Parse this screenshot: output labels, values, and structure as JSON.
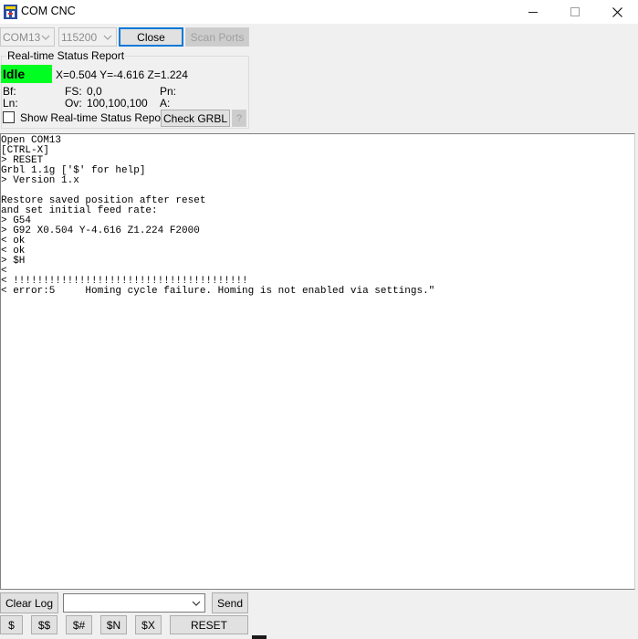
{
  "window": {
    "title": "COM CNC",
    "icons": [
      "app-icon",
      "minimize-icon",
      "maximize-icon",
      "close-icon"
    ]
  },
  "toolbar": {
    "port": "COM13",
    "baud": "115200",
    "close_label": "Close",
    "scan_label": "Scan Ports"
  },
  "status": {
    "group_title": "Real-time Status Report",
    "state": "Idle",
    "state_color": "#00ff20",
    "coords": "X=0.504 Y=-4.616 Z=1.224",
    "bf_label": "Bf:",
    "fs_label": "FS:",
    "fs_value": "0,0",
    "pn_label": "Pn:",
    "ln_label": "Ln:",
    "ov_label": "Ov:",
    "ov_value": "100,100,100",
    "a_label": "A:",
    "show_label": "Show Real-time Status Report",
    "check_label": "Check GRBL",
    "help_label": "?"
  },
  "console": {
    "lines": [
      "Open COM13",
      "[CTRL-X]",
      "> RESET",
      "Grbl 1.1g ['$' for help]",
      "> Version 1.x",
      "",
      "Restore saved position after reset",
      "and set initial feed rate:",
      "> G54",
      "> G92 X0.504 Y-4.616 Z1.224 F2000",
      "< ok",
      "< ok",
      "> $H",
      "<",
      "< !!!!!!!!!!!!!!!!!!!!!!!!!!!!!!!!!!!!!!!",
      "< error:5     Homing cycle failure. Homing is not enabled via settings.\""
    ]
  },
  "bottom": {
    "clear_label": "Clear Log",
    "command_value": "",
    "send_label": "Send",
    "btn_dollar": "$",
    "btn_dollar2": "$$",
    "btn_hash": "$#",
    "btn_n": "$N",
    "btn_x": "$X",
    "reset_label": "RESET"
  }
}
